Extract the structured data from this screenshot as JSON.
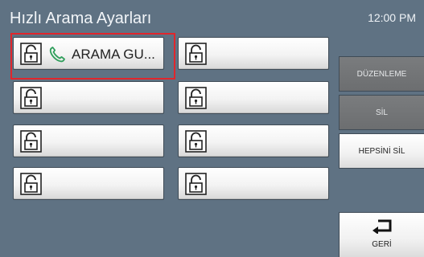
{
  "header": {
    "title": "Hızlı Arama Ayarları",
    "clock": "12:00 PM"
  },
  "slots": [
    {
      "label": "ARAMA GU...",
      "has_phone_icon": true
    },
    {
      "label": ""
    },
    {
      "label": ""
    },
    {
      "label": ""
    },
    {
      "label": ""
    },
    {
      "label": ""
    },
    {
      "label": ""
    },
    {
      "label": ""
    }
  ],
  "sidebar": {
    "edit": {
      "label": "DÜZENLEME",
      "state": "disabled"
    },
    "delete": {
      "label": "SİL",
      "state": "disabled"
    },
    "delete_all": {
      "label": "HEPSİNİ SİL",
      "state": "enabled"
    },
    "back": {
      "label": "GERİ"
    }
  },
  "colors": {
    "background": "#5f7283",
    "highlight": "#e0262c",
    "phone_icon": "#2e9e5a"
  }
}
